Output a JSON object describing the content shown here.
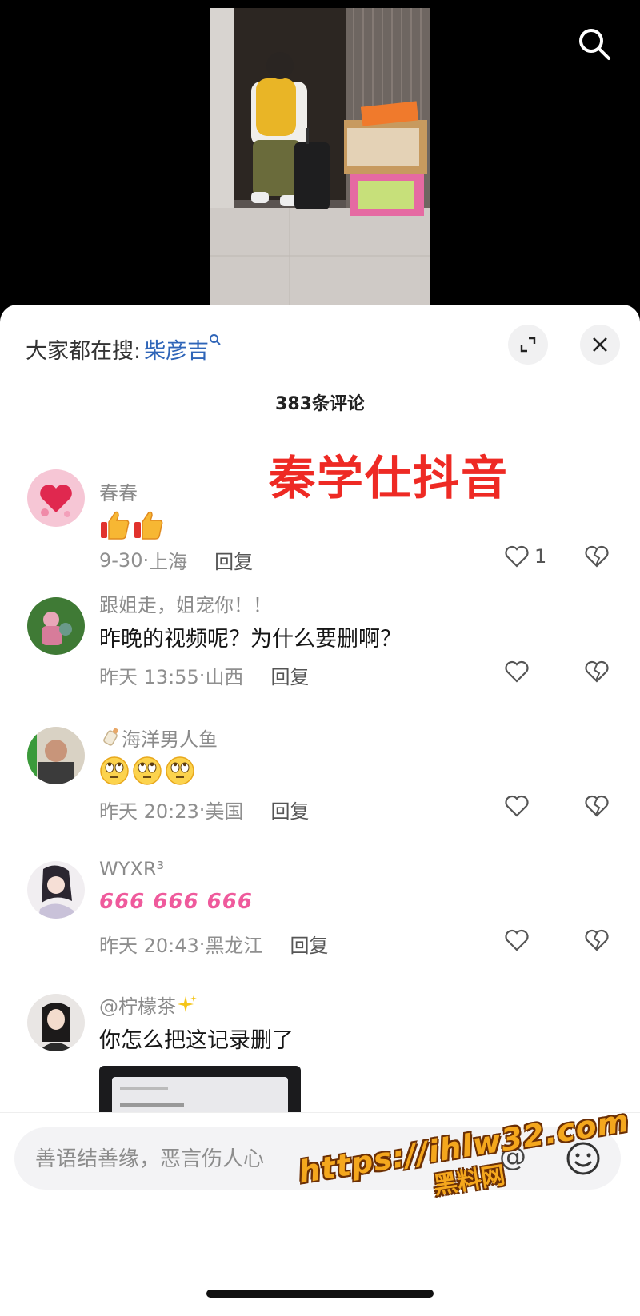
{
  "video": {
    "search_icon": "search-icon"
  },
  "sheet": {
    "search_prefix": "大家都在搜:",
    "search_keyword": "柴彦吉",
    "title": "383条评论",
    "overlay_brand": "秦学仕抖音"
  },
  "comments": [
    {
      "user": "春春",
      "text": "",
      "emoji": "👍👍",
      "date": "9-30",
      "location": "上海",
      "reply": "回复",
      "likes": "1"
    },
    {
      "user": "跟姐走，姐宠你！！",
      "text": "昨晚的视频呢？为什么要删啊？",
      "emoji": "",
      "date": "昨天 13:55",
      "location": "山西",
      "reply": "回复",
      "likes": ""
    },
    {
      "user": "海洋男人鱼",
      "user_prefix_emoji": "🍼",
      "text": "",
      "emoji": "🙄🙄🙄",
      "date": "昨天 20:23",
      "location": "美国",
      "reply": "回复",
      "likes": ""
    },
    {
      "user": "WYXR³",
      "text": "",
      "emoji": "666 666 666",
      "date": "昨天 20:43",
      "location": "黑龙江",
      "reply": "回复",
      "likes": ""
    },
    {
      "user": "@柠檬茶",
      "user_suffix_emoji": "✨",
      "text": "你怎么把这记录删了",
      "emoji": "",
      "date": "",
      "location": "",
      "reply": "",
      "likes": ""
    }
  ],
  "input": {
    "placeholder": "善语结善缘，恶言伤人心",
    "at_symbol": "@"
  },
  "watermark": {
    "url": "https://ihlw32.com",
    "cn": "黑料网"
  },
  "colors": {
    "accent_blue": "#2f65b8",
    "brand_red": "#ee2a24",
    "watermark_orange": "#f4a71d"
  }
}
